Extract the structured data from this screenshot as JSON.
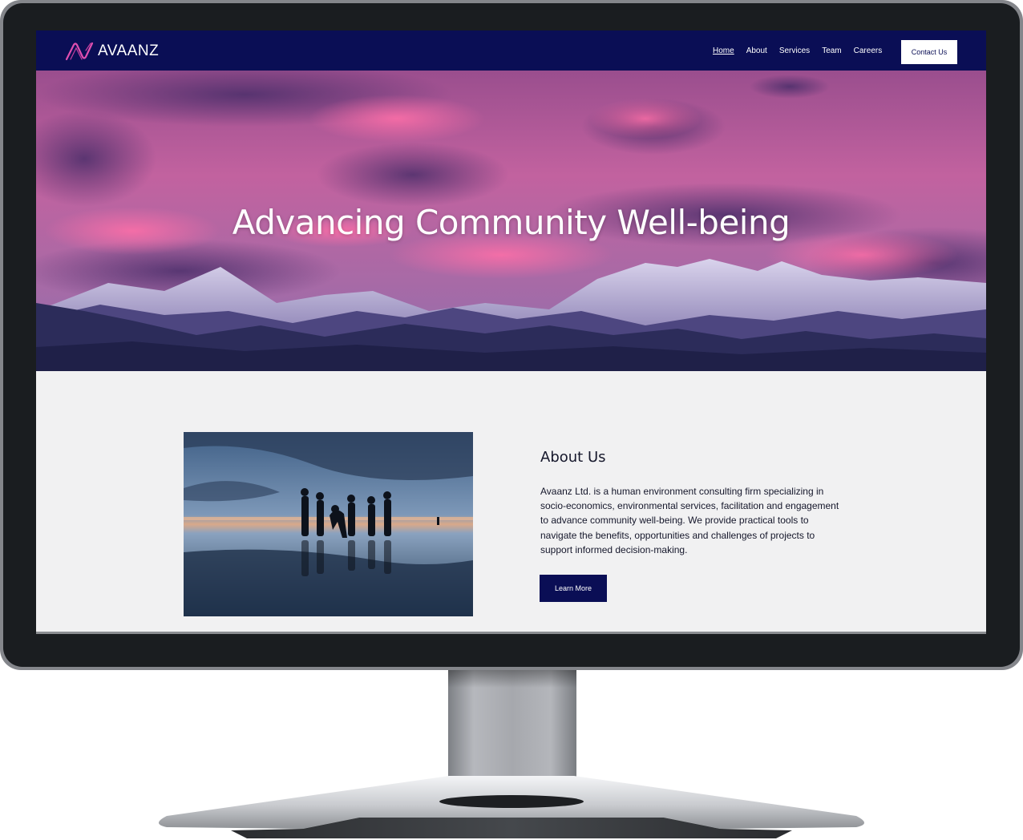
{
  "brand": {
    "name": "AVAANZ",
    "accent": "#e04fb0",
    "primary": "#0a0e55"
  },
  "nav": {
    "items": [
      {
        "label": "Home",
        "active": true
      },
      {
        "label": "About",
        "active": false
      },
      {
        "label": "Services",
        "active": false
      },
      {
        "label": "Team",
        "active": false
      },
      {
        "label": "Careers",
        "active": false
      }
    ],
    "contact_label": "Contact Us"
  },
  "hero": {
    "title": "Advancing Community Well-being"
  },
  "about": {
    "title": "About Us",
    "body": "Avaanz Ltd. is a human environment consulting firm specializing in socio-economics, environmental services, facilitation and engagement to advance community well-being. We provide practical tools to navigate the benefits, opportunities and challenges of projects to support informed decision-making.",
    "button_label": "Learn More"
  }
}
